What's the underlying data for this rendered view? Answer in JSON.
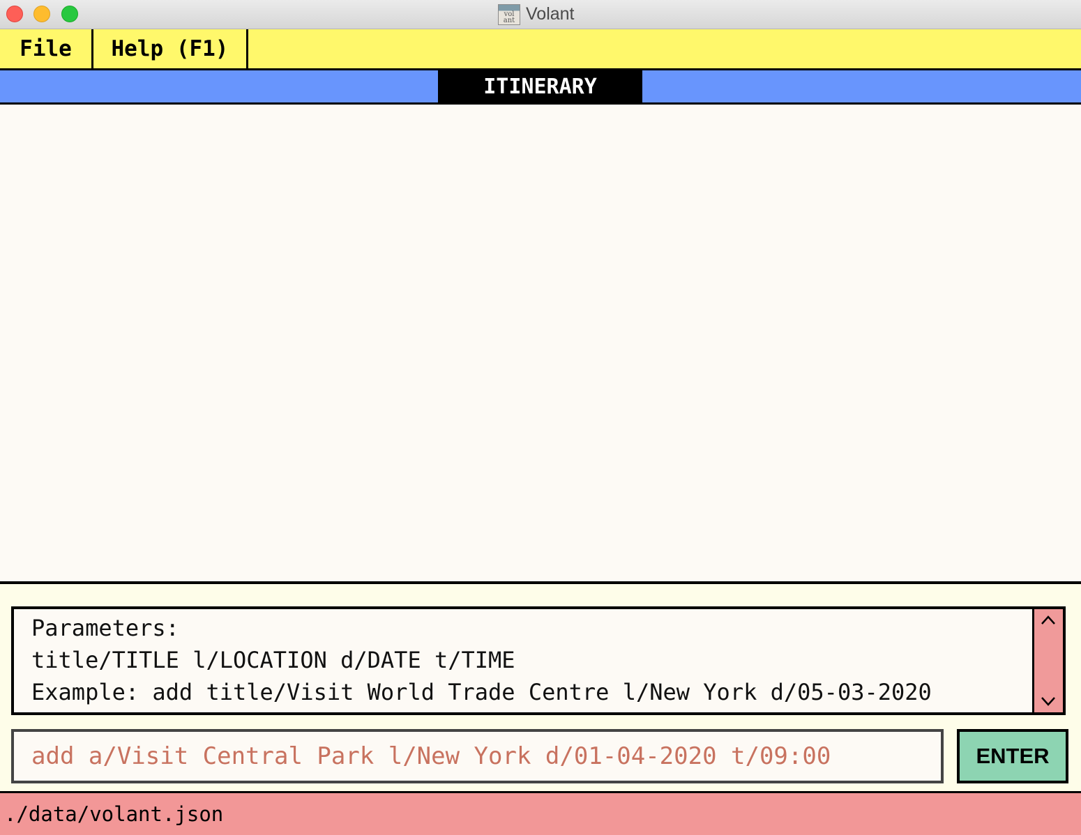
{
  "window": {
    "title": "Volant",
    "app_icon_text": "vol ant",
    "controls": [
      "close",
      "minimize",
      "maximize"
    ]
  },
  "menu": {
    "items": [
      {
        "label": "File"
      },
      {
        "label": "Help (F1)"
      }
    ]
  },
  "tabs": {
    "active": "ITINERARY"
  },
  "result": {
    "lines": [
      "Parameters:",
      "title/TITLE l/LOCATION d/DATE t/TIME",
      "Example: add title/Visit World Trade Centre l/New York d/05-03-2020"
    ]
  },
  "command": {
    "value": "add a/Visit Central Park l/New York d/01-04-2020 t/09:00",
    "button_label": "ENTER"
  },
  "status": {
    "path": "./data/volant.json"
  },
  "icons": {
    "scroll_up": "chevron-up-icon",
    "scroll_down": "chevron-down-icon"
  },
  "colors": {
    "menubar": "#fff86b",
    "tabbar": "#6895fd",
    "active_tab": "#000000",
    "command_text": "#c8725f",
    "enter_button": "#8dd4b2",
    "statusbar": "#f29797",
    "scrollbar": "#f09a9a"
  }
}
